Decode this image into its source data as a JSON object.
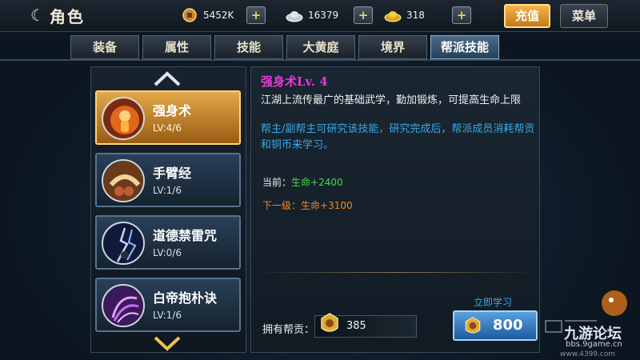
{
  "header": {
    "title": "角色",
    "resources": [
      {
        "icon": "copper-coin-icon",
        "value": "5452K"
      },
      {
        "icon": "silver-ingot-icon",
        "value": "16379"
      },
      {
        "icon": "gold-ingot-icon",
        "value": "318"
      }
    ],
    "recharge_label": "充值",
    "menu_label": "菜单"
  },
  "tabs": [
    {
      "label": "装备",
      "active": false
    },
    {
      "label": "属性",
      "active": false
    },
    {
      "label": "技能",
      "active": false
    },
    {
      "label": "大黄庭",
      "active": false
    },
    {
      "label": "境界",
      "active": false
    },
    {
      "label": "帮派技能",
      "active": true
    }
  ],
  "skills": [
    {
      "name": "强身术",
      "level": "LV:4/6",
      "icon": "fire-spirit-icon",
      "active": true
    },
    {
      "name": "手臂经",
      "level": "LV:1/6",
      "icon": "fist-icon",
      "active": false
    },
    {
      "name": "道德禁雷咒",
      "level": "LV:0/6",
      "icon": "lightning-icon",
      "active": false
    },
    {
      "name": "白帝抱朴诀",
      "level": "LV:1/6",
      "icon": "purple-swirl-icon",
      "active": false
    }
  ],
  "detail": {
    "title": "强身术Lv. 4",
    "description": "江湖上流传最广的基础武学，勤加锻炼，可提高生命上限",
    "note": "帮主/副帮主可研究该技能，研究完成后，帮派成员消耗帮贡和铜币来学习。",
    "current_label": "当前：",
    "current_value": "生命+2400",
    "next_label": "下一级：",
    "next_value": "生命+3100"
  },
  "footer": {
    "contribution_label": "拥有帮贡：",
    "contribution_value": "385",
    "learn_label": "立即学习",
    "learn_cost": "800"
  },
  "watermark": {
    "text": "九游论坛",
    "url": "bbs.9game.cn",
    "url2": "www.4399.com"
  },
  "colors": {
    "accent_gold": "#e3a84a",
    "title_magenta": "#e23ad8",
    "note_blue": "#3aa8e8",
    "current_green": "#4ad84a",
    "next_orange": "#f08a28"
  }
}
